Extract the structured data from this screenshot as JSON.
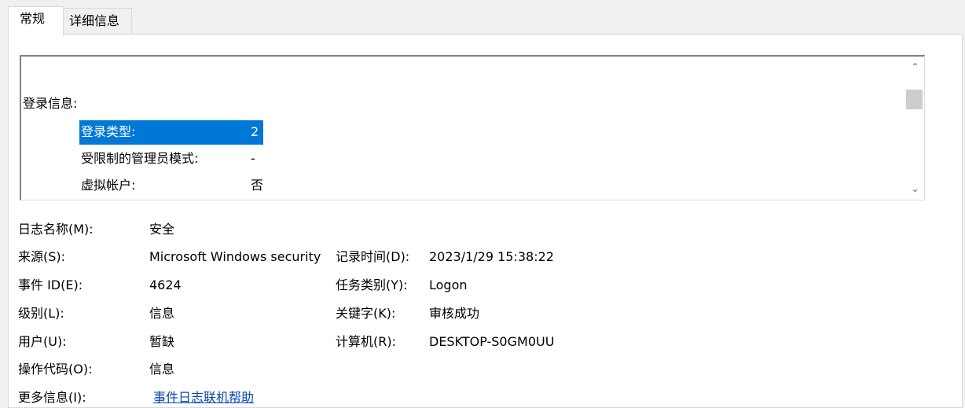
{
  "tabs": [
    {
      "label": "常规"
    },
    {
      "label": "详细信息"
    }
  ],
  "description": {
    "section_title": "登录信息:",
    "rows": [
      {
        "label": "登录类型:",
        "value": "2"
      },
      {
        "label": "受限制的管理员模式:",
        "value": "-"
      },
      {
        "label": "虚拟帐户:",
        "value": "否"
      }
    ]
  },
  "fields": {
    "log_name_label": "日志名称(M):",
    "log_name_value": "安全",
    "source_label": "来源(S):",
    "source_value": "Microsoft Windows security",
    "logged_label": "记录时间(D):",
    "logged_value": "2023/1/29 15:38:22",
    "event_id_label": "事件 ID(E):",
    "event_id_value": "4624",
    "task_category_label": "任务类别(Y):",
    "task_category_value": "Logon",
    "level_label": "级别(L):",
    "level_value": "信息",
    "keywords_label": "关键字(K):",
    "keywords_value": "审核成功",
    "user_label": "用户(U):",
    "user_value": "暂缺",
    "computer_label": "计算机(R):",
    "computer_value": "DESKTOP-S0GM0UU",
    "opcode_label": "操作代码(O):",
    "opcode_value": "信息",
    "more_info_label": "更多信息(I):",
    "more_info_link": "事件日志联机帮助"
  },
  "icons": {
    "scroll_up": "chevron-up-icon",
    "scroll_down": "chevron-down-icon"
  },
  "colors": {
    "selection": "#0078d7",
    "link": "#0645ad",
    "panel": "#ffffff",
    "window": "#f0f0f0"
  }
}
